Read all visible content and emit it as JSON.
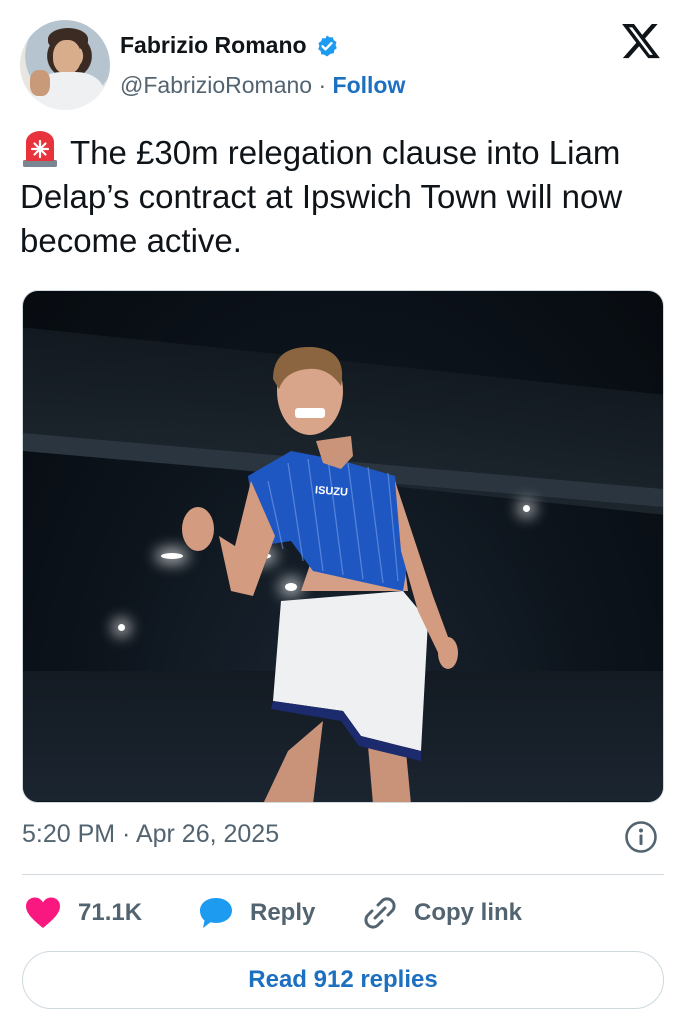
{
  "author": {
    "name": "Fabrizio Romano",
    "handle": "@FabrizioRomano",
    "separator": "·",
    "follow_label": "Follow",
    "verified_icon": "verified-badge-icon",
    "avatar_icon": "avatar-photo"
  },
  "platform_icon": "x-logo-icon",
  "tweet": {
    "emoji_icon": "rotating-light-icon",
    "text": "The £30m relegation clause into Liam Delap’s contract at Ipswich Town will now become active.",
    "image_icon": "player-celebration-photo",
    "image_shirt_text": "ISUZU"
  },
  "meta": {
    "timestamp": "5:20 PM · Apr 26, 2025",
    "info_icon": "info-icon"
  },
  "actions": {
    "likes": "71.1K",
    "reply_label": "Reply",
    "copy_link_label": "Copy link",
    "like_icon": "heart-icon",
    "reply_icon": "reply-bubble-icon",
    "link_icon": "link-icon"
  },
  "read_replies_label": "Read 912 replies",
  "colors": {
    "text": "#0f1419",
    "secondary": "#536471",
    "link_blue": "#1d6fc0",
    "verified_blue": "#1d9bf0",
    "like_pink": "#f91880",
    "border": "#cfd9de"
  }
}
